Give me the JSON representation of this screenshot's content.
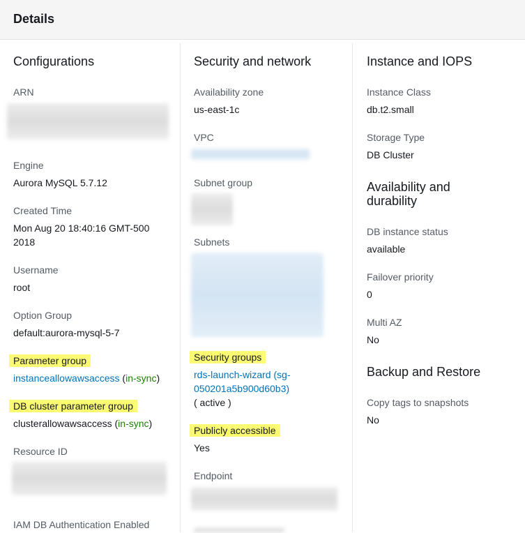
{
  "header": {
    "title": "Details"
  },
  "configurations": {
    "heading": "Configurations",
    "arn_label": "ARN",
    "engine_label": "Engine",
    "engine_value": "Aurora MySQL 5.7.12",
    "created_label": "Created Time",
    "created_line1": "Mon Aug 20 18:40:16 GMT-500",
    "created_line2": "2018",
    "username_label": "Username",
    "username_value": "root",
    "option_group_label": "Option Group",
    "option_group_value": "default:aurora-mysql-5-7",
    "parameter_group_label": "Parameter group",
    "parameter_group_link": "instanceallowawsaccess",
    "parameter_group_status": "in-sync",
    "cluster_param_label": "DB cluster parameter group",
    "cluster_param_value": "clusterallowawsaccess",
    "cluster_param_status": "in-sync",
    "resource_id_label": "Resource ID",
    "iam_label": "IAM DB Authentication Enabled"
  },
  "security": {
    "heading": "Security and network",
    "az_label": "Availability zone",
    "az_value": "us-east-1c",
    "vpc_label": "VPC",
    "subnet_group_label": "Subnet group",
    "subnets_label": "Subnets",
    "security_groups_label": "Security groups",
    "security_group_link_line1": "rds-launch-wizard (sg-",
    "security_group_link_line2": "050201a5b900d60b3)",
    "security_group_status": "( active )",
    "public_label": "Publicly accessible",
    "public_value": "Yes",
    "endpoint_label": "Endpoint"
  },
  "instance": {
    "heading": "Instance and IOPS",
    "class_label": "Instance Class",
    "class_value": "db.t2.small",
    "storage_label": "Storage Type",
    "storage_value": "DB Cluster",
    "availability_heading_line1": "Availability and",
    "availability_heading_line2": "durability",
    "status_label": "DB instance status",
    "status_value": "available",
    "failover_label": "Failover priority",
    "failover_value": "0",
    "multi_az_label": "Multi AZ",
    "multi_az_value": "No",
    "backup_heading": "Backup and Restore",
    "copy_tags_label": "Copy tags to snapshots",
    "copy_tags_value": "No"
  },
  "colors": {
    "link": "#0073bb",
    "status_ok": "#1d8102",
    "highlight": "#fbfb73",
    "header_bg": "#f5f5f5"
  }
}
